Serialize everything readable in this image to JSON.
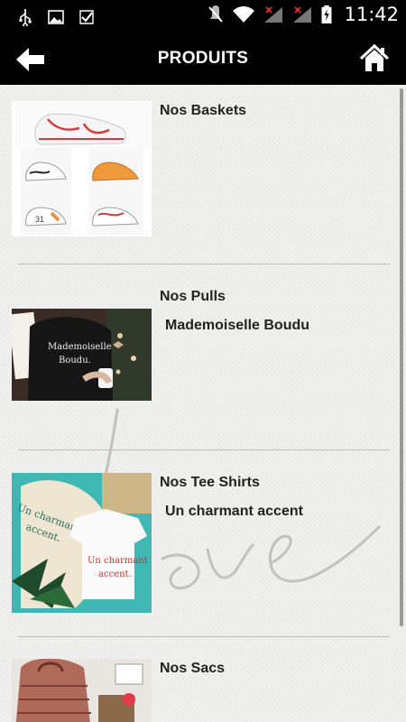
{
  "status_bar": {
    "time": "11:42",
    "icons": [
      "usb-icon",
      "image-icon",
      "check-icon",
      "mute-icon",
      "wifi-icon",
      "signal-icon",
      "signal-icon",
      "battery-charging-icon"
    ]
  },
  "header": {
    "title": "PRODUITS",
    "back_icon": "arrow-left-icon",
    "home_icon": "home-icon"
  },
  "products": [
    {
      "title": "Nos Baskets",
      "subtitle": ""
    },
    {
      "title": "Nos Pulls",
      "subtitle": "Mademoiselle Boudu"
    },
    {
      "title": "Nos Tee Shirts",
      "subtitle": "Un charmant accent"
    },
    {
      "title": "Nos Sacs",
      "subtitle": ""
    }
  ],
  "colors": {
    "bar": "#000000",
    "background": "#f2f2f1",
    "accent_red": "#d43a3a"
  }
}
